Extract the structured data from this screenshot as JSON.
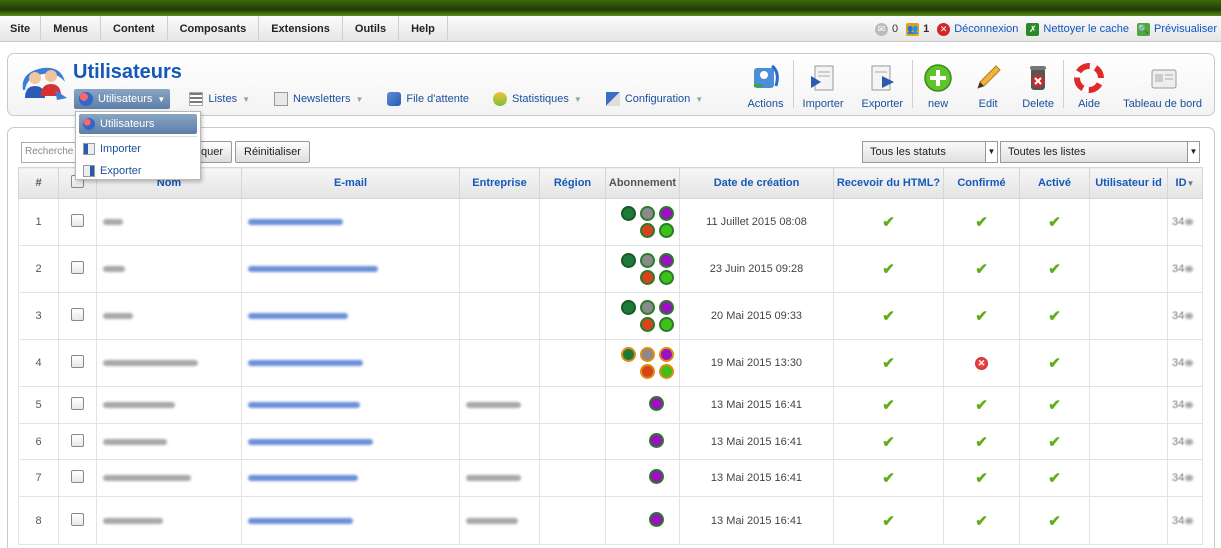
{
  "menubar": {
    "items": [
      "Site",
      "Menus",
      "Content",
      "Composants",
      "Extensions",
      "Outils",
      "Help"
    ],
    "status": {
      "messages_count": "0",
      "users_count": "1",
      "logout": "Déconnexion",
      "clear_cache": "Nettoyer le cache",
      "preview": "Prévisualiser"
    }
  },
  "header": {
    "title": "Utilisateurs"
  },
  "subnav": [
    {
      "label": "Utilisateurs",
      "has_arrow": true
    },
    {
      "label": "Listes",
      "has_arrow": true
    },
    {
      "label": "Newsletters",
      "has_arrow": true
    },
    {
      "label": "File d'attente",
      "has_arrow": false
    },
    {
      "label": "Statistiques",
      "has_arrow": true
    },
    {
      "label": "Configuration",
      "has_arrow": true
    }
  ],
  "dropdown": {
    "items": [
      "Utilisateurs",
      "Importer",
      "Exporter"
    ]
  },
  "toolbar": {
    "actions": "Actions",
    "import": "Importer",
    "export": "Exporter",
    "new": "new",
    "edit": "Edit",
    "delete": "Delete",
    "help": "Aide",
    "dashboard": "Tableau de bord"
  },
  "filters": {
    "search_placeholder": "Recherche",
    "apply_button": "quer",
    "reset_button": "Réinitialiser",
    "status_select": "Tous les statuts",
    "lists_select": "Toutes les listes"
  },
  "table": {
    "columns": [
      "#",
      "",
      "Nom",
      "E-mail",
      "Entreprise",
      "Région",
      "Abonnement",
      "Date de création",
      "Recevoir du HTML?",
      "Confirmé",
      "Activé",
      "Utilisateur id",
      "ID"
    ],
    "rows": [
      {
        "num": "1",
        "date": "11 Juillet 2015 08:08",
        "confirmed": true,
        "dots": "full-green",
        "id_prefix": "34"
      },
      {
        "num": "2",
        "date": "23 Juin 2015 09:28",
        "confirmed": true,
        "dots": "full-green",
        "id_prefix": "34"
      },
      {
        "num": "3",
        "date": "20 Mai 2015 09:33",
        "confirmed": true,
        "dots": "full-green",
        "id_prefix": "34"
      },
      {
        "num": "4",
        "date": "19 Mai 2015 13:30",
        "confirmed": false,
        "dots": "full-orange",
        "id_prefix": "34"
      },
      {
        "num": "5",
        "date": "13 Mai 2015 16:41",
        "confirmed": true,
        "dots": "single",
        "id_prefix": "34"
      },
      {
        "num": "6",
        "date": "13 Mai 2015 16:41",
        "confirmed": true,
        "dots": "single",
        "id_prefix": "34"
      },
      {
        "num": "7",
        "date": "13 Mai 2015 16:41",
        "confirmed": true,
        "dots": "single",
        "id_prefix": "34"
      },
      {
        "num": "8",
        "date": "13 Mai 2015 16:41",
        "confirmed": true,
        "dots": "single",
        "id_prefix": "34"
      }
    ]
  },
  "colors": {
    "accent": "#1459b8",
    "check": "#5fae1a",
    "dot_green": "#1e7a3a",
    "dot_grey": "#8a8a8a",
    "dot_purple": "#9b10c0",
    "dot_red": "#d8431a",
    "dot_lime": "#3ec01a",
    "topstrip": "#2d5208"
  }
}
